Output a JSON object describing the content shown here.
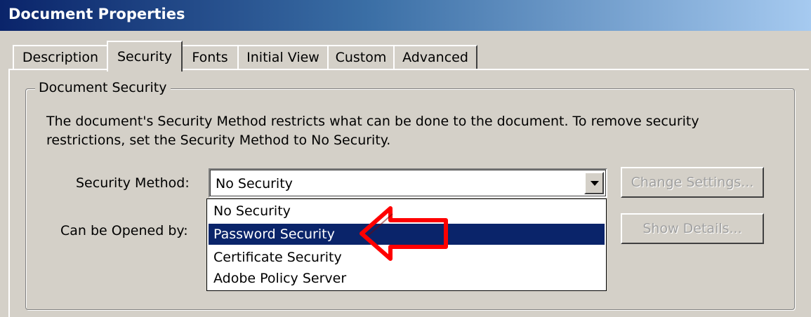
{
  "window": {
    "title": "Document Properties"
  },
  "tabs": [
    {
      "label": "Description"
    },
    {
      "label": "Security",
      "active": true
    },
    {
      "label": "Fonts"
    },
    {
      "label": "Initial View"
    },
    {
      "label": "Custom"
    },
    {
      "label": "Advanced"
    }
  ],
  "security": {
    "group_title": "Document Security",
    "description_line1": "The document's Security Method restricts what can be done to the document. To remove security",
    "description_line2": "restrictions, set the Security Method to No Security.",
    "method_label": "Security Method:",
    "method_value": "No Security",
    "opened_by_label": "Can be Opened by:",
    "change_settings_label": "Change Settings...",
    "show_details_label": "Show Details...",
    "dropdown_options": [
      {
        "label": "No Security"
      },
      {
        "label": "Password Security",
        "highlighted": true
      },
      {
        "label": "Certificate Security"
      },
      {
        "label": "Adobe Policy Server"
      }
    ]
  },
  "colors": {
    "selection": "#0a246a",
    "annotation_arrow": "#ff0000",
    "dialog_face": "#d4d0c8"
  },
  "icons": {
    "dropdown_arrow": "chevron-down-icon",
    "annotation": "red-left-arrow-annotation"
  }
}
